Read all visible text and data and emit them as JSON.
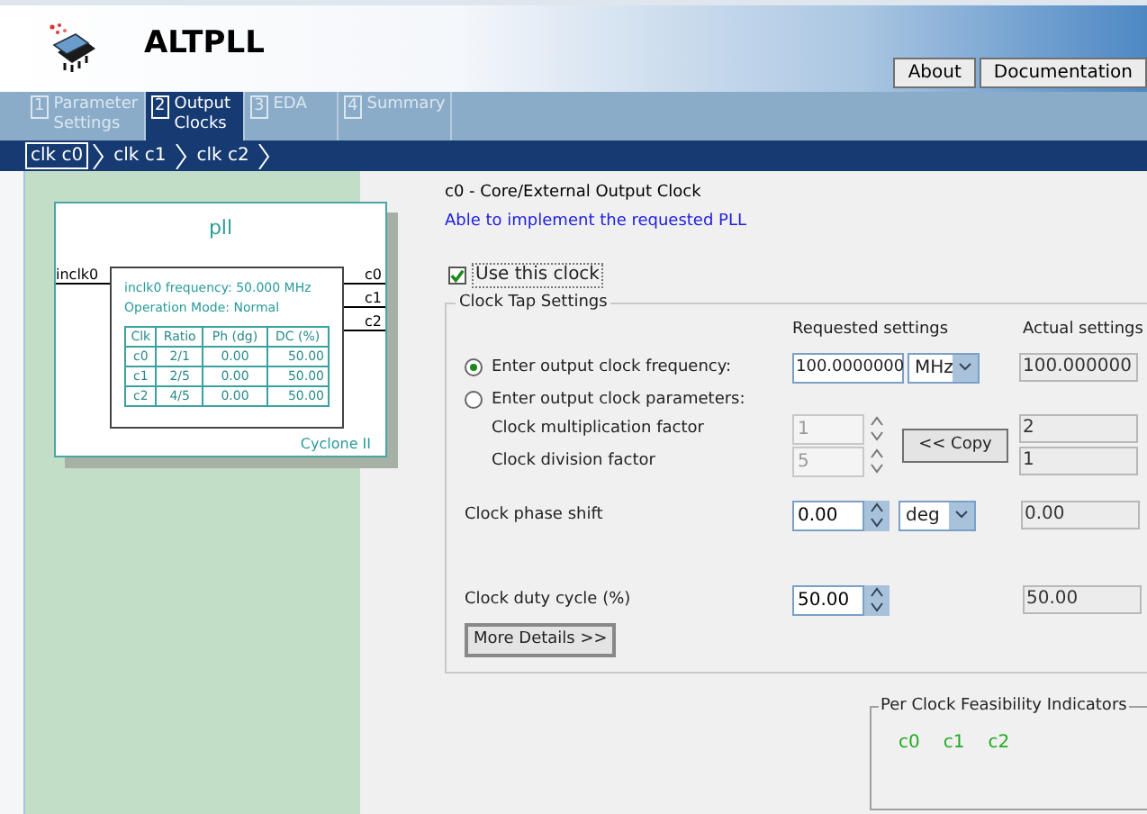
{
  "header": {
    "title": "ALTPLL",
    "buttons": [
      "About",
      "Documentation"
    ]
  },
  "tabs": [
    {
      "number": "1",
      "label": "Parameter Settings",
      "selected": false
    },
    {
      "number": "2",
      "label": "Output Clocks",
      "selected": true
    },
    {
      "number": "3",
      "label": "EDA",
      "selected": false
    },
    {
      "number": "4",
      "label": "Summary",
      "selected": false
    }
  ],
  "breadcrumb": [
    {
      "label": "clk c0",
      "selected": true
    },
    {
      "label": "clk c1",
      "selected": false
    },
    {
      "label": "clk c2",
      "selected": false
    }
  ],
  "diagram": {
    "title": "pll",
    "input": "inclk0",
    "outputs": [
      "c0",
      "c1",
      "c2"
    ],
    "info": [
      "inclk0 frequency: 50.000 MHz",
      "Operation Mode: Normal"
    ],
    "table": {
      "columns": [
        "Clk",
        "Ratio",
        "Ph (dg)",
        "DC (%)"
      ],
      "rows": [
        [
          "c0",
          "2/1",
          "0.00",
          "50.00"
        ],
        [
          "c1",
          "2/5",
          "0.00",
          "50.00"
        ],
        [
          "c2",
          "4/5",
          "0.00",
          "50.00"
        ]
      ]
    },
    "device": "Cyclone II"
  },
  "panel": {
    "heading": "c0 - Core/External Output Clock",
    "status": "Able to implement the requested PLL",
    "use_clock": {
      "label": "Use this clock",
      "checked": true
    },
    "group_title": "Clock Tap Settings",
    "requested_header": "Requested settings",
    "actual_header": "Actual settings",
    "options": [
      {
        "label": "Enter output clock frequency:",
        "selected": true
      },
      {
        "label": "Enter output clock parameters:",
        "selected": false
      }
    ],
    "frequency": {
      "value": "100.0000000",
      "unit": "MHz",
      "actual": "100.000000"
    },
    "multiplication": {
      "label": "Clock multiplication factor",
      "value": "1",
      "actual": "2",
      "disabled": true
    },
    "division": {
      "label": "Clock division factor",
      "value": "5",
      "actual": "1",
      "disabled": true
    },
    "copy_button": "<< Copy",
    "phase": {
      "label": "Clock phase shift",
      "value": "0.00",
      "unit": "deg",
      "actual": "0.00"
    },
    "duty": {
      "label": "Clock duty cycle (%)",
      "value": "50.00",
      "actual": "50.00"
    },
    "more_button": "More Details >>"
  },
  "feasibility": {
    "title": "Per Clock Feasibility Indicators",
    "clocks": [
      {
        "label": "c0",
        "color": "#22aa22"
      },
      {
        "label": "c1",
        "color": "#22aa22"
      },
      {
        "label": "c2",
        "color": "#22aa22"
      }
    ]
  }
}
